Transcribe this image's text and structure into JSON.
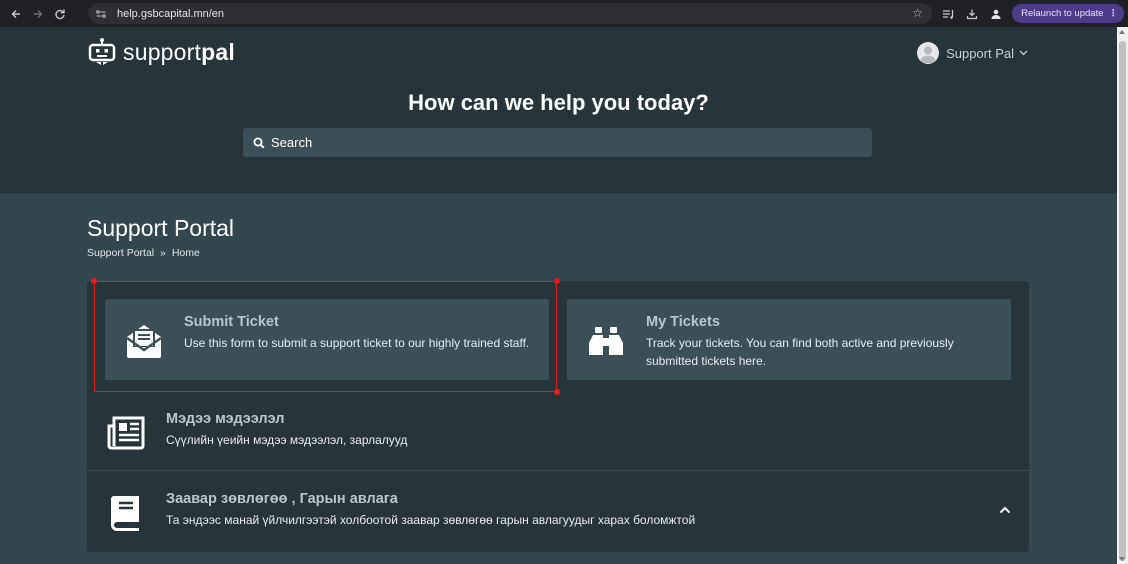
{
  "browser": {
    "url": "help.gsbcapital.mn/en",
    "relaunch_label": "Relaunch to update"
  },
  "header": {
    "logo_prefix": "support",
    "logo_suffix": "pal",
    "user_name": "Support Pal",
    "hero_title": "How can we help you today?",
    "search_label": "Search"
  },
  "main": {
    "page_title": "Support Portal",
    "breadcrumb": [
      "Support Portal",
      "»",
      "Home"
    ],
    "cards": [
      {
        "title": "Submit Ticket",
        "description": "Use this form to submit a support ticket to our highly trained staff.",
        "icon": "envelope-open-icon"
      },
      {
        "title": "My Tickets",
        "description": "Track your tickets. You can find both active and previously submitted tickets here.",
        "icon": "binoculars-icon"
      }
    ],
    "sections": [
      {
        "title": "Мэдээ мэдээлэл",
        "description": "Сүүлийн үеийн мэдээ мэдээлэл, зарлалууд",
        "icon": "newspaper-icon"
      },
      {
        "title": "Заавар зөвлөгөө , Гарын авлага",
        "description": "Та эндээс манай үйлчилгээтэй холбоотой заавар зөвлөгөө гарын авлагуудыг харах боломжтой",
        "icon": "book-icon"
      }
    ]
  },
  "colors": {
    "header_bg": "#273439",
    "body_bg": "#34474f",
    "card_bg": "#3c4f57",
    "highlight": "#e01d1d",
    "relaunch_bg": "#4d3c8a"
  }
}
